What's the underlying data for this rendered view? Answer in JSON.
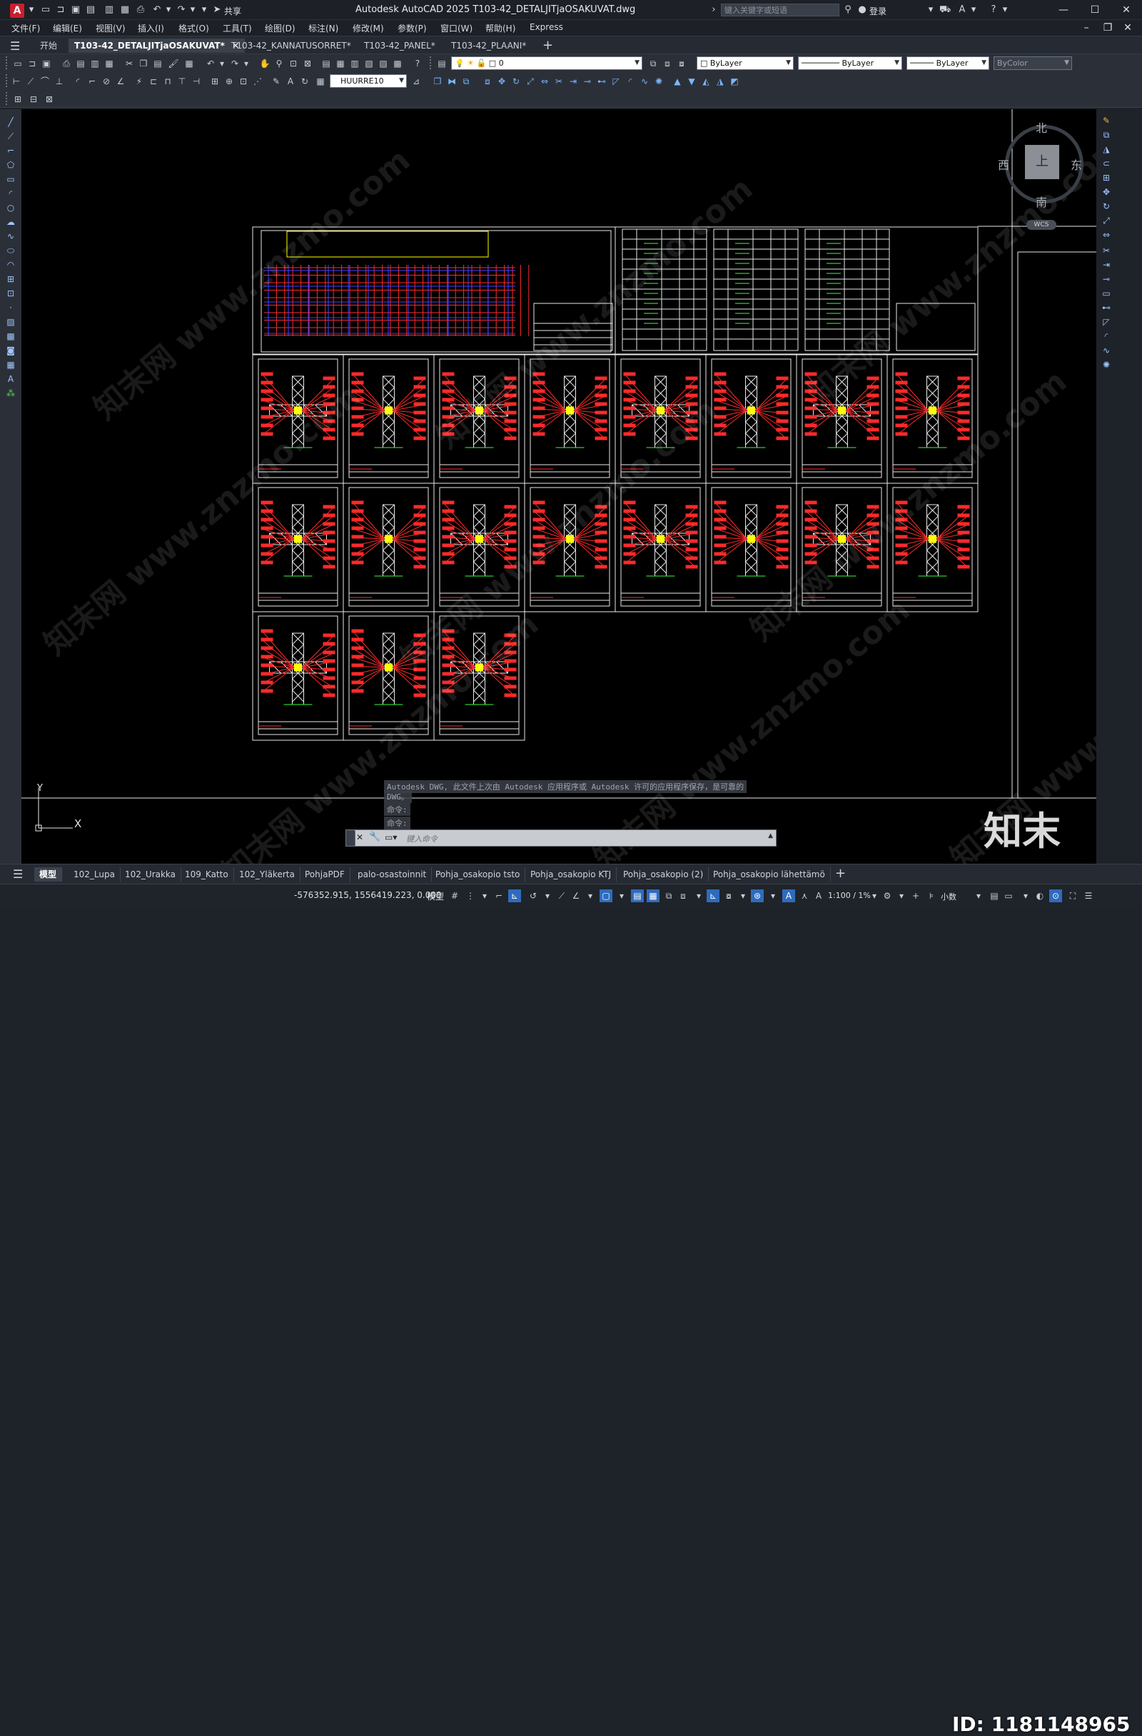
{
  "app": {
    "icon_letter": "A",
    "title": "Autodesk AutoCAD 2025    T103-42_DETALJITjaOSAKUVAT.dwg",
    "share_label": "共享",
    "search_placeholder": "键入关键字或短语",
    "login_label": "登录"
  },
  "menu": [
    "文件(F)",
    "编辑(E)",
    "视图(V)",
    "插入(I)",
    "格式(O)",
    "工具(T)",
    "绘图(D)",
    "标注(N)",
    "修改(M)",
    "参数(P)",
    "窗口(W)",
    "帮助(H)",
    "Express"
  ],
  "doc_tabs": [
    {
      "label": "开始",
      "active": false
    },
    {
      "label": "T103-42_DETALJITjaOSAKUVAT*",
      "active": true
    },
    {
      "label": "T103-42_KANNATUSORRET*",
      "active": false
    },
    {
      "label": "T103-42_PANEL*",
      "active": false
    },
    {
      "label": "T103-42_PLAANI*",
      "active": false
    }
  ],
  "toolbars": {
    "layer_value": "0",
    "color_value": "ByLayer",
    "linetype_value": "ByLayer",
    "lineweight_value": "ByLayer",
    "plotstyle_value": "ByColor",
    "dimstyle_value": "HUURRE10"
  },
  "viewcube": {
    "north": "北",
    "south": "南",
    "east": "东",
    "west": "西",
    "face": "上",
    "wcs": "WCS"
  },
  "ucs": {
    "x_label": "X",
    "y_label": "Y"
  },
  "command": {
    "history": [
      "Autodesk DWG,  此文件上次由 Autodesk 应用程序或 Autodesk 许可的应用程序保存，是可靠的",
      "DWG。",
      "命令:",
      "命令:"
    ],
    "placeholder": "键入命令"
  },
  "layout_tabs": [
    {
      "label": "模型",
      "active": true
    },
    {
      "label": "102_Lupa",
      "active": false
    },
    {
      "label": "102_Urakka",
      "active": false
    },
    {
      "label": "109_Katto",
      "active": false
    },
    {
      "label": "102_Yläkerta",
      "active": false
    },
    {
      "label": "PohjaPDF",
      "active": false
    },
    {
      "label": "palo-osastoinnit",
      "active": false
    },
    {
      "label": "Pohja_osakopio tsto",
      "active": false
    },
    {
      "label": "Pohja_osakopio KTJ",
      "active": false
    },
    {
      "label": "Pohja_osakopio (2)",
      "active": false
    },
    {
      "label": "Pohja_osakopio lähettämö",
      "active": false
    }
  ],
  "status": {
    "coordinates": "-576352.915, 1556419.223, 0.000",
    "space": "模型",
    "scale": "1:100 / 1%",
    "units": "小数"
  },
  "overlay": {
    "brand": "知末",
    "id": "ID: 1181148965",
    "watermark": "知末网 www.znzmo.com"
  },
  "colors": {
    "canvas": "#000000",
    "accent": "#2f6bbd",
    "drawing_red": "#ff2a2a",
    "drawing_white": "#e8e8e8",
    "drawing_green": "#33ff33",
    "drawing_yellow": "#ffff00"
  }
}
